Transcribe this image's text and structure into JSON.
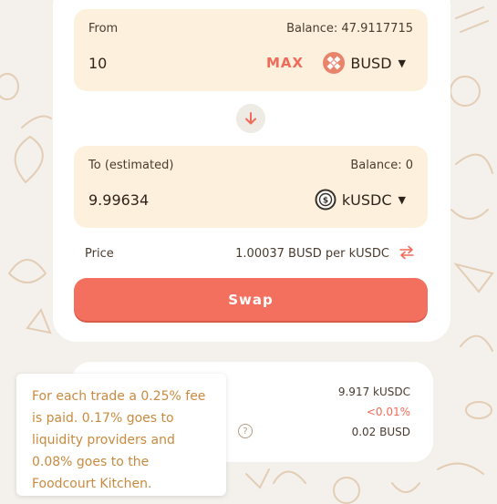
{
  "from": {
    "label": "From",
    "balance": "Balance: 47.9117715",
    "amount": "10",
    "max_label": "MAX",
    "token": "BUSD",
    "token_icon": "busd-icon"
  },
  "to": {
    "label": "To (estimated)",
    "balance": "Balance: 0",
    "amount": "9.99634",
    "token": "kUSDC",
    "token_icon": "kusdc-icon"
  },
  "price": {
    "label": "Price",
    "value": "1.00037 BUSD per kUSDC"
  },
  "swap_label": "Swap",
  "details": {
    "minimum_received": "9.917 kUSDC",
    "price_impact": "<0.01%",
    "fee": "0.02 BUSD",
    "help_glyph": "?"
  },
  "tooltip": {
    "text": "For each trade a 0.25% fee is paid. 0.17% goes to liquidity providers and 0.08% goes to the Foodcourt Kitchen."
  },
  "colors": {
    "accent": "#f4705e",
    "panel": "#fdf1de",
    "background": "#f4f1ec",
    "tooltip_text": "#c98a3f"
  }
}
